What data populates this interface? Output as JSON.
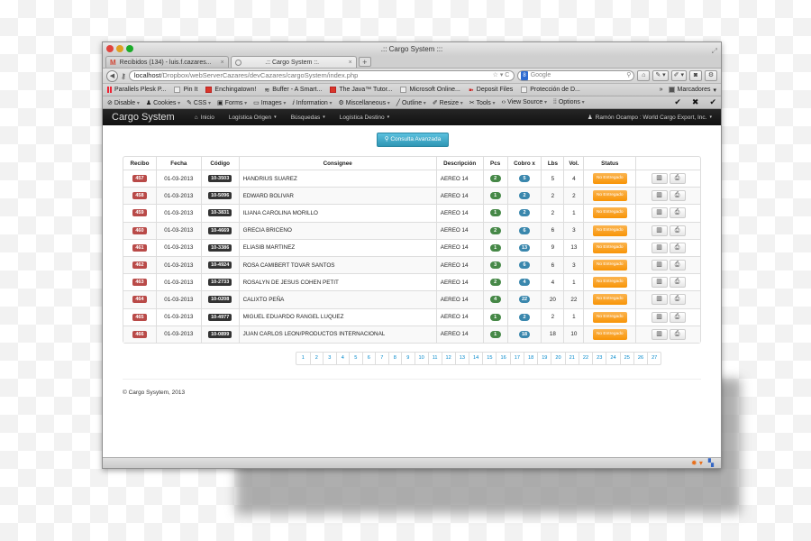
{
  "browser": {
    "window_title": ".:: Cargo System :::",
    "tabs": [
      {
        "label": "Recibidos (134) - luis.f.cazares...",
        "icon": "gmail-icon",
        "active": false
      },
      {
        "label": ".:: Cargo System ::.",
        "icon": "loading-icon",
        "active": true
      }
    ],
    "url_host": "localhost",
    "url_path": "/Dropbox/webServerCazares/devCazares/cargoSystem/index.php",
    "search_placeholder": "Google",
    "bookmarks": [
      {
        "label": "Parallels Plesk P...",
        "icon": "parallels-icon"
      },
      {
        "label": "Pin It",
        "icon": "page-icon"
      },
      {
        "label": "Enchingatown!",
        "icon": "enchingatown-icon"
      },
      {
        "label": "Buffer - A Smart...",
        "icon": "buffer-icon"
      },
      {
        "label": "The Java™ Tutor...",
        "icon": "java-icon"
      },
      {
        "label": "Microsoft Online...",
        "icon": "page-icon"
      },
      {
        "label": "Deposit Files",
        "icon": "depositfiles-icon"
      },
      {
        "label": "Protección de D...",
        "icon": "page-icon"
      }
    ],
    "bookmarks_more": "»",
    "bookmarks_menu": "Marcadores",
    "devtools": [
      "Disable",
      "Cookies",
      "CSS",
      "Forms",
      "Images",
      "Information",
      "Miscellaneous",
      "Outline",
      "Resize",
      "Tools",
      "View Source",
      "Options"
    ]
  },
  "app": {
    "brand": "Cargo System",
    "nav": [
      {
        "label": "Inicio",
        "icon": "home-icon",
        "dropdown": false
      },
      {
        "label": "Logística Origen",
        "dropdown": true
      },
      {
        "label": "Búsquedas",
        "dropdown": true
      },
      {
        "label": "Logística Destino",
        "dropdown": true
      }
    ],
    "user": "Ramón Ocampo : World Cargo Export, Inc.",
    "advanced_search": "Consulta Avanzada",
    "table": {
      "headers": [
        "Recibo",
        "Fecha",
        "Código",
        "Consignee",
        "Descripción",
        "Pcs",
        "Cobro x",
        "Lbs",
        "Vol.",
        "Status",
        ""
      ],
      "rows": [
        {
          "recibo": "457",
          "fecha": "01-03-2013",
          "codigo": "10-3503",
          "consignee": "HANDRIUS SUAREZ",
          "descripcion": "AEREO 14",
          "pcs": "2",
          "cobro": "5",
          "lbs": "5",
          "vol": "4",
          "status": "No Entregado"
        },
        {
          "recibo": "458",
          "fecha": "01-03-2013",
          "codigo": "10-5096",
          "consignee": "EDWARD BOLIVAR",
          "descripcion": "AEREO 14",
          "pcs": "1",
          "cobro": "2",
          "lbs": "2",
          "vol": "2",
          "status": "No Entregado"
        },
        {
          "recibo": "459",
          "fecha": "01-03-2013",
          "codigo": "10-3831",
          "consignee": "ILIANA CAROLINA MORILLO",
          "descripcion": "AEREO 14",
          "pcs": "1",
          "cobro": "2",
          "lbs": "2",
          "vol": "1",
          "status": "No Entregado"
        },
        {
          "recibo": "460",
          "fecha": "01-03-2013",
          "codigo": "10-4669",
          "consignee": "GRECIA BRICENO",
          "descripcion": "AEREO 14",
          "pcs": "2",
          "cobro": "6",
          "lbs": "6",
          "vol": "3",
          "status": "No Entregado"
        },
        {
          "recibo": "461",
          "fecha": "01-03-2013",
          "codigo": "10-3386",
          "consignee": "ELIASIB MARTINEZ",
          "descripcion": "AEREO 14",
          "pcs": "1",
          "cobro": "13",
          "lbs": "9",
          "vol": "13",
          "status": "No Entregado"
        },
        {
          "recibo": "462",
          "fecha": "01-03-2013",
          "codigo": "10-4924",
          "consignee": "ROSA CAMIBERT TOVAR SANTOS",
          "descripcion": "AEREO 14",
          "pcs": "3",
          "cobro": "6",
          "lbs": "6",
          "vol": "3",
          "status": "No Entregado"
        },
        {
          "recibo": "463",
          "fecha": "01-03-2013",
          "codigo": "10-2733",
          "consignee": "ROSALYN DE JESUS COHEN PETIT",
          "descripcion": "AEREO 14",
          "pcs": "2",
          "cobro": "4",
          "lbs": "4",
          "vol": "1",
          "status": "No Entregado"
        },
        {
          "recibo": "464",
          "fecha": "01-03-2013",
          "codigo": "10-0208",
          "consignee": "CALIXTO PEÑA",
          "descripcion": "AEREO 14",
          "pcs": "4",
          "cobro": "22",
          "lbs": "20",
          "vol": "22",
          "status": "No Entregado"
        },
        {
          "recibo": "465",
          "fecha": "01-03-2013",
          "codigo": "10-4977",
          "consignee": "MIGUEL EDUARDO RANGEL LUQUEZ",
          "descripcion": "AEREO 14",
          "pcs": "1",
          "cobro": "2",
          "lbs": "2",
          "vol": "1",
          "status": "No Entregado"
        },
        {
          "recibo": "466",
          "fecha": "01-03-2013",
          "codigo": "10-0899",
          "consignee": "JUAN CARLOS LEON/PRODUCTOS INTERNACIONAL",
          "descripcion": "AEREO 14",
          "pcs": "1",
          "cobro": "18",
          "lbs": "18",
          "vol": "10",
          "status": "No Entregado"
        }
      ],
      "row_actions": [
        {
          "name": "barcode-icon",
          "glyph": "▥"
        },
        {
          "name": "print-icon",
          "glyph": "⎙"
        }
      ]
    },
    "pagination": [
      "1",
      "2",
      "3",
      "4",
      "5",
      "6",
      "7",
      "8",
      "9",
      "10",
      "11",
      "12",
      "13",
      "14",
      "15",
      "16",
      "17",
      "18",
      "19",
      "20",
      "21",
      "22",
      "23",
      "24",
      "25",
      "26",
      "27"
    ],
    "footer": "© Cargo Sysytem, 2013"
  },
  "colors": {
    "navbar_bg": "#1b1b1b",
    "recibo_label": "#b94a48",
    "codigo_label": "#333333",
    "pcs_badge": "#468847",
    "cobro_badge": "#3a87ad",
    "status_button": "#f89406",
    "info_button": "#49afcd",
    "link": "#0088cc"
  }
}
